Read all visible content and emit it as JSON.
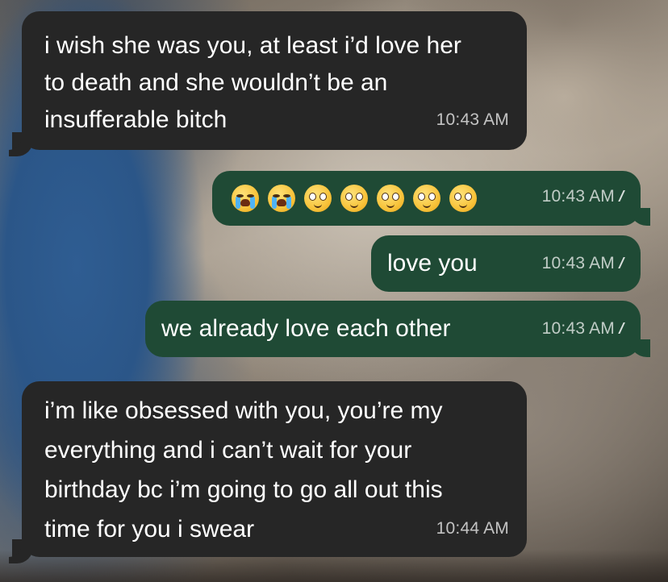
{
  "messages": [
    {
      "direction": "incoming",
      "text": "i wish she was you, at least i’d love her\nto death and she wouldn’t be an\ninsufferable bitch",
      "time": "10:43 AM"
    },
    {
      "direction": "outgoing",
      "emojis": [
        "loudly-crying-face",
        "loudly-crying-face",
        "pleading-face",
        "pleading-face",
        "pleading-face",
        "pleading-face",
        "pleading-face"
      ],
      "time": "10:43 AM",
      "status": "read"
    },
    {
      "direction": "outgoing",
      "text": "love you",
      "time": "10:43 AM",
      "status": "read"
    },
    {
      "direction": "outgoing",
      "text": "we already love each other",
      "time": "10:43 AM",
      "status": "read"
    },
    {
      "direction": "incoming",
      "text": "i’m like obsessed with you, you’re my\neverything and i can’t wait for your\nbirthday bc i’m going to go all out this\ntime for you i swear",
      "time": "10:44 AM"
    }
  ],
  "colors": {
    "incoming_bubble": "#262626",
    "outgoing_bubble": "#1f4a35",
    "timestamp": "#b8b8b8"
  },
  "icons": {
    "read_receipt": "double-check-icon"
  }
}
